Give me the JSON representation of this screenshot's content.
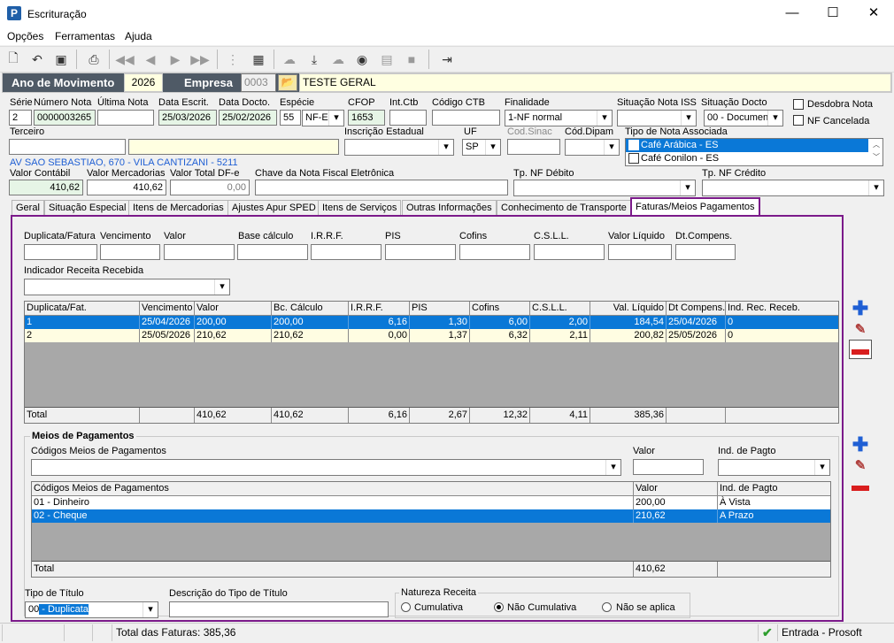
{
  "window": {
    "title": "Escrituração"
  },
  "menu": [
    "Opções",
    "Ferramentas",
    "Ajuda"
  ],
  "toolbar": {
    "icons": [
      "new-doc-icon",
      "undo-icon",
      "save-icon",
      "preview-icon",
      "first-icon",
      "prev-icon",
      "next-icon",
      "last-icon",
      "tree-icon",
      "calc-icon",
      "cloud-icon",
      "import-icon",
      "cloud2-icon",
      "cib-icon",
      "layout-icon",
      "box-icon",
      "exit-icon"
    ]
  },
  "header": {
    "ano_label": "Ano de Movimento",
    "ano": "2026",
    "empresa_label": "Empresa",
    "empresa_code": "0003",
    "empresa_name": "TESTE GERAL"
  },
  "form": {
    "serie_label": "Série",
    "serie": "2",
    "numero_label": "Número Nota",
    "numero": "0000003265",
    "ultima_label": "Última Nota",
    "ultima": "",
    "data_escrit_label": "Data Escrit.",
    "data_escrit": "25/03/2026",
    "data_docto_label": "Data Docto.",
    "data_docto": "25/02/2026",
    "especie_label": "Espécie",
    "especie_code": "55",
    "especie": "NF-E",
    "cfop_label": "CFOP",
    "cfop": "1653",
    "intctb_label": "Int.Ctb",
    "intctb": "",
    "codctb_label": "Código CTB",
    "codctb": "",
    "finalidade_label": "Finalidade",
    "finalidade": "1-NF normal",
    "sit_iss_label": "Situação Nota ISS",
    "sit_iss": "",
    "sit_docto_label": "Situação Docto",
    "sit_docto": "00 - Document",
    "desdobra_label": "Desdobra Nota",
    "cancelada_label": "NF Cancelada",
    "terceiro_label": "Terceiro",
    "terceiro_code": "",
    "terceiro_name": "",
    "ie_label": "Inscrição Estadual",
    "ie": "",
    "uf_label": "UF",
    "uf": "SP",
    "sinac_label": "Cod.Sinac",
    "sinac": "",
    "dipam_label": "Cód.Dipam",
    "dipam": "",
    "tipo_assoc_label": "Tipo de Nota Associada",
    "tipo_assoc": [
      "Café Arábica - ES",
      "Café Conilon - ES"
    ],
    "address": "AV SAO SEBASTIAO, 670 - VILA CANTIZANI - 5211",
    "valor_contabil_label": "Valor Contábil",
    "valor_contabil": "410,62",
    "valor_merc_label": "Valor Mercadorias",
    "valor_merc": "410,62",
    "valor_dfe_label": "Valor Total DF-e",
    "valor_dfe": "0,00",
    "chave_label": "Chave da Nota Fiscal Eletrônica",
    "chave": "",
    "tp_debito_label": "Tp. NF Débito",
    "tp_debito": "",
    "tp_credito_label": "Tp. NF Crédito",
    "tp_credito": ""
  },
  "tabs": [
    "Geral",
    "Situação Especial",
    "Itens de Mercadorias",
    "Ajustes Apur SPED",
    "Itens de Serviços",
    "Outras Informações",
    "Conhecimento de Transporte",
    "Faturas/Meios Pagamentos"
  ],
  "faturas": {
    "inputs": [
      "Duplicata/Fatura",
      "Vencimento",
      "Valor",
      "Base cálculo",
      "I.R.R.F.",
      "PIS",
      "Cofins",
      "C.S.L.L.",
      "Valor Líquido",
      "Dt.Compens."
    ],
    "indicador_label": "Indicador Receita Recebida",
    "columns": [
      "Duplicata/Fat.",
      "Vencimento",
      "Valor",
      "Bc. Cálculo",
      "I.R.R.F.",
      "PIS",
      "Cofins",
      "C.S.L.L.",
      "Val. Líquido",
      "Dt Compens.",
      "Ind. Rec. Receb."
    ],
    "rows": [
      [
        "1",
        "25/04/2026",
        "200,00",
        "200,00",
        "6,16",
        "1,30",
        "6,00",
        "2,00",
        "184,54",
        "25/04/2026",
        "0"
      ],
      [
        "2",
        "25/05/2026",
        "210,62",
        "210,62",
        "0,00",
        "1,37",
        "6,32",
        "2,11",
        "200,82",
        "25/05/2026",
        "0"
      ]
    ],
    "total": [
      "Total",
      "",
      "410,62",
      "410,62",
      "6,16",
      "2,67",
      "12,32",
      "4,11",
      "385,36",
      "",
      ""
    ]
  },
  "meios": {
    "group_label": "Meios de Pagamentos",
    "codigo_label": "Códigos Meios de Pagamentos",
    "valor_label": "Valor",
    "ind_label": "Ind. de Pagto",
    "columns": [
      "Códigos Meios de Pagamentos",
      "Valor",
      "Ind. de Pagto"
    ],
    "rows": [
      [
        "01 - Dinheiro",
        "200,00",
        "À Vista"
      ],
      [
        "02 - Cheque",
        "210,62",
        "A Prazo"
      ]
    ],
    "total": [
      "Total",
      "410,62",
      ""
    ]
  },
  "bottom": {
    "tipo_titulo_label": "Tipo de Título",
    "tipo_titulo_code": "00",
    "tipo_titulo": " - Duplicata",
    "desc_label": "Descrição do Tipo de Título",
    "desc": "",
    "natureza_label": "Natureza Receita",
    "natureza": [
      "Cumulativa",
      "Não Cumulativa",
      "Não se aplica"
    ],
    "natureza_selected": 1
  },
  "status": {
    "total": "Total das Faturas: 385,36",
    "mode": "Entrada - Prosoft"
  }
}
